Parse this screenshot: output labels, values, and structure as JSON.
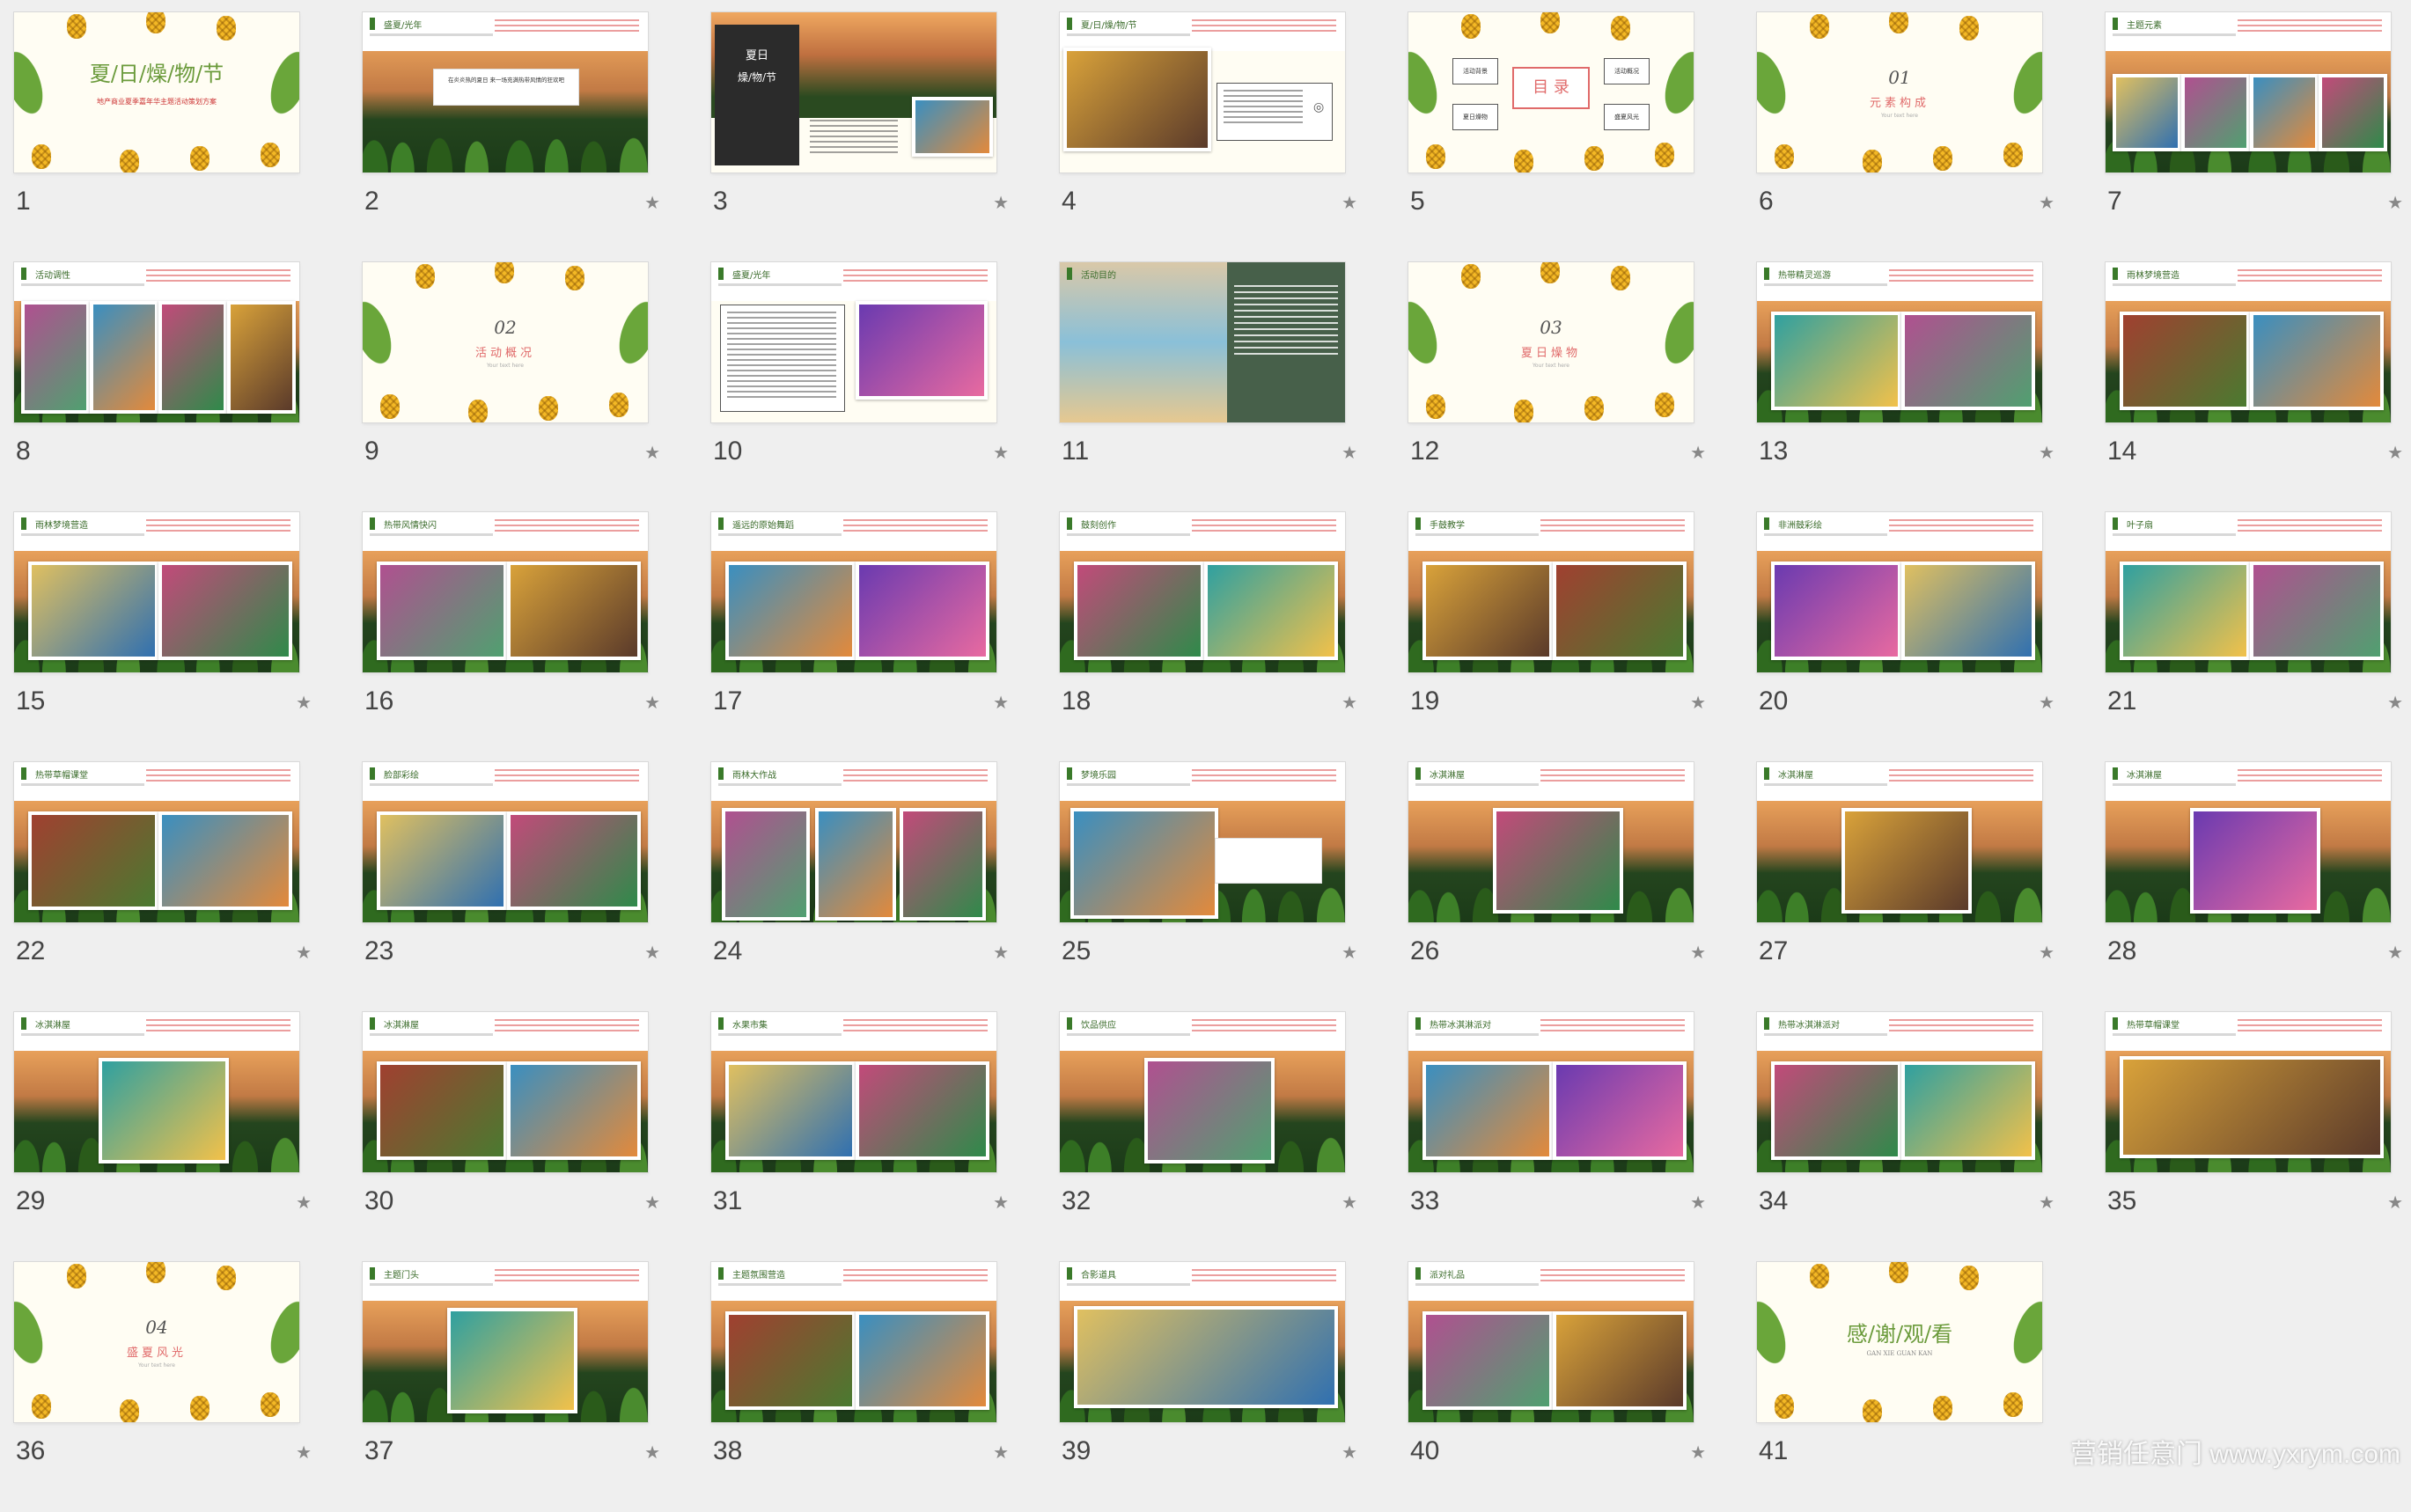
{
  "slides": [
    {
      "n": "1",
      "star": false,
      "type": "cover",
      "title": "夏/日/燥/物/节",
      "subtitle": "地产商业夏季嘉年华主题活动策划方案"
    },
    {
      "n": "2",
      "star": true,
      "type": "intro",
      "tag": "盛夏/光年",
      "caption": "在炎炎热的夏日 来一场充满热带风情的狂欢吧"
    },
    {
      "n": "3",
      "star": true,
      "type": "dark",
      "title": "夏日",
      "subtitle": "燥/物/节"
    },
    {
      "n": "4",
      "star": true,
      "type": "pineapple",
      "tag": "夏/日/燥/物/节"
    },
    {
      "n": "5",
      "star": false,
      "type": "toc",
      "toc": "目 录",
      "items": [
        "活动背景",
        "活动概况",
        "夏日燥物",
        "盛夏风光"
      ]
    },
    {
      "n": "6",
      "star": true,
      "type": "chapter",
      "num": "01",
      "name": "元素构成",
      "en": "Your text here"
    },
    {
      "n": "7",
      "star": true,
      "type": "photos4",
      "tag": "主题元素"
    },
    {
      "n": "8",
      "star": false,
      "type": "photos4b",
      "tag": "活动调性"
    },
    {
      "n": "9",
      "star": true,
      "type": "chapter",
      "num": "02",
      "name": "活动概况",
      "en": "Your text here"
    },
    {
      "n": "10",
      "star": true,
      "type": "textimg",
      "tag": "盛夏/光年"
    },
    {
      "n": "11",
      "star": true,
      "type": "green",
      "tag": "活动目的"
    },
    {
      "n": "12",
      "star": true,
      "type": "chapter",
      "num": "03",
      "name": "夏日燥物",
      "en": "Your text here"
    },
    {
      "n": "13",
      "star": true,
      "type": "photos2",
      "tag": "热带精灵巡游"
    },
    {
      "n": "14",
      "star": true,
      "type": "photos2",
      "tag": "雨林梦境营造"
    },
    {
      "n": "15",
      "star": true,
      "type": "photos2",
      "tag": "雨林梦境营造"
    },
    {
      "n": "16",
      "star": true,
      "type": "photos2",
      "tag": "热带风情快闪"
    },
    {
      "n": "17",
      "star": true,
      "type": "photos2",
      "tag": "遥远的原始舞蹈"
    },
    {
      "n": "18",
      "star": true,
      "type": "photos2",
      "tag": "鼓刻创作"
    },
    {
      "n": "19",
      "star": true,
      "type": "photos2",
      "tag": "手鼓教学"
    },
    {
      "n": "20",
      "star": true,
      "type": "photos2",
      "tag": "非洲鼓彩绘"
    },
    {
      "n": "21",
      "star": true,
      "type": "photos2",
      "tag": "叶子扇"
    },
    {
      "n": "22",
      "star": true,
      "type": "photos2",
      "tag": "热带草帽课堂"
    },
    {
      "n": "23",
      "star": true,
      "type": "photos2",
      "tag": "脸部彩绘"
    },
    {
      "n": "24",
      "star": true,
      "type": "photos3",
      "tag": "雨林大作战"
    },
    {
      "n": "25",
      "star": true,
      "type": "photo1box",
      "tag": "梦境乐园"
    },
    {
      "n": "26",
      "star": true,
      "type": "photo1",
      "tag": "冰淇淋屋"
    },
    {
      "n": "27",
      "star": true,
      "type": "photo1",
      "tag": "冰淇淋屋"
    },
    {
      "n": "28",
      "star": true,
      "type": "photo1",
      "tag": "冰淇淋屋"
    },
    {
      "n": "29",
      "star": true,
      "type": "photo1",
      "tag": "冰淇淋屋"
    },
    {
      "n": "30",
      "star": true,
      "type": "photos2",
      "tag": "冰淇淋屋"
    },
    {
      "n": "31",
      "star": true,
      "type": "photos2",
      "tag": "水果市集"
    },
    {
      "n": "32",
      "star": true,
      "type": "photo1",
      "tag": "饮品供应"
    },
    {
      "n": "33",
      "star": true,
      "type": "photos2",
      "tag": "热带冰淇淋派对"
    },
    {
      "n": "34",
      "star": true,
      "type": "photos2",
      "tag": "热带冰淇淋派对"
    },
    {
      "n": "35",
      "star": true,
      "type": "photo1wide",
      "tag": "热带草帽课堂"
    },
    {
      "n": "36",
      "star": true,
      "type": "chapter",
      "num": "04",
      "name": "盛夏风光",
      "en": "Your text here"
    },
    {
      "n": "37",
      "star": true,
      "type": "photo1",
      "tag": "主题门头"
    },
    {
      "n": "38",
      "star": true,
      "type": "photos2",
      "tag": "主题氛围营造"
    },
    {
      "n": "39",
      "star": true,
      "type": "photo1wide",
      "tag": "合影道具"
    },
    {
      "n": "40",
      "star": true,
      "type": "photos2",
      "tag": "派对礼品"
    },
    {
      "n": "41",
      "star": false,
      "type": "thanks",
      "title": "感/谢/观/看",
      "en": "GAN XIE GUAN KAN"
    }
  ],
  "star_glyph": "★",
  "watermark": "营销任意门 www.yxrym.com"
}
